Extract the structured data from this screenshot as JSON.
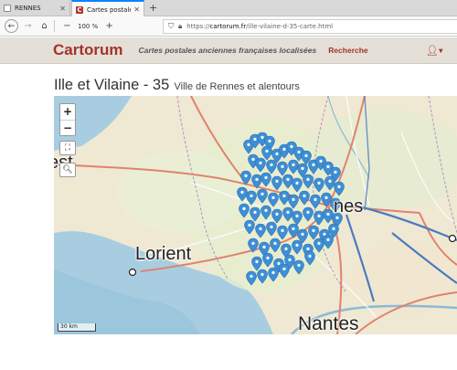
{
  "browser": {
    "tabs": [
      {
        "label": "RENNES",
        "active": false
      },
      {
        "label": "Cartes postales",
        "active": true
      }
    ],
    "zoom": "100 %",
    "url_prefix": "https://",
    "url_host": "cartorum.fr",
    "url_path": "/ille-vilaine-d-35-carte.html"
  },
  "site": {
    "brand": "Cartorum",
    "tagline": "Cartes postales anciennes françaises localisées",
    "nav": {
      "search": "Recherche"
    },
    "colors": {
      "brand": "#a5322c",
      "header_bg": "#e4e0d7"
    }
  },
  "page": {
    "title": "Ille et Vilaine - 35",
    "subtitle": "Ville de Rennes et alentours"
  },
  "map": {
    "labels": {
      "lorient": "Lorient",
      "rennes_fragment": "nes",
      "nantes": "Nantes",
      "left_fragment": "est"
    },
    "scale": "30 km",
    "zoom_in": "+",
    "zoom_out": "−",
    "marker_color": "#3d8fd6",
    "icons": [
      "fullscreen-icon",
      "search-icon"
    ]
  }
}
